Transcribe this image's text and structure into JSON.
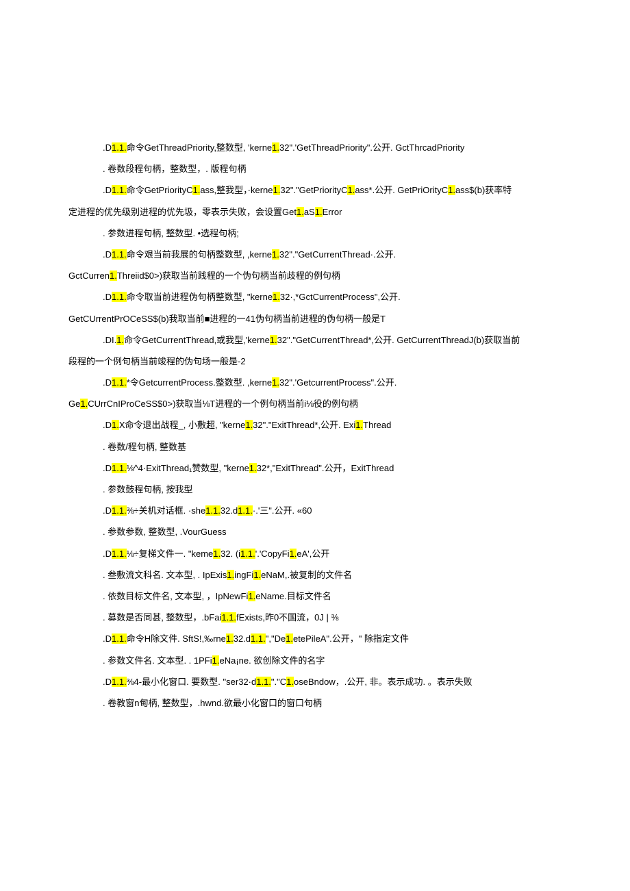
{
  "highlight_color": "#ffff00",
  "lines": [
    {
      "indent": 1,
      "segments": [
        {
          "t": ".D"
        },
        {
          "t": "1.1.",
          "h": true
        },
        {
          "t": "命令GetThreadPriority,整数型, 'kerne"
        },
        {
          "t": "1.",
          "h": true
        },
        {
          "t": "32\".'GetThreadPriority\".公开. GctThrcadPriority"
        }
      ]
    },
    {
      "indent": 1,
      "segments": [
        {
          "t": ". 卷数段程句柄，整数型，. 版程句柄"
        }
      ]
    },
    {
      "indent": 1,
      "segments": [
        {
          "t": ".D"
        },
        {
          "t": "1.1.",
          "h": true
        },
        {
          "t": "命令GetPriorityC"
        },
        {
          "t": "1.",
          "h": true
        },
        {
          "t": "ass,整我型，·kerne"
        },
        {
          "t": "1.",
          "h": true
        },
        {
          "t": "32\".\"GetPriorityC"
        },
        {
          "t": "1.",
          "h": true
        },
        {
          "t": "ass*.公开. GetPriOrityC"
        },
        {
          "t": "1.",
          "h": true
        },
        {
          "t": "ass$(b)获率特"
        }
      ]
    },
    {
      "indent": 0,
      "segments": [
        {
          "t": "定进程的优先级别进程的优先圾，零表示失败，会设置Get"
        },
        {
          "t": "1.",
          "h": true
        },
        {
          "t": "aS"
        },
        {
          "t": "1.",
          "h": true
        },
        {
          "t": "Error"
        }
      ]
    },
    {
      "indent": 1,
      "segments": [
        {
          "t": ". 参数进程句柄, 整数型. •选程句柄;"
        }
      ]
    },
    {
      "indent": 1,
      "segments": [
        {
          "t": ".D"
        },
        {
          "t": "1.1.",
          "h": true
        },
        {
          "t": "命令艰当前我展的句柄整数型, ,kerne"
        },
        {
          "t": "1.",
          "h": true
        },
        {
          "t": "32\".\"GetCurrentThread·.公开."
        }
      ]
    },
    {
      "indent": 0,
      "segments": [
        {
          "t": "GctCurren"
        },
        {
          "t": "1.",
          "h": true
        },
        {
          "t": "Threiid$0>)获取当前践程的一个伪句柄当前歧程的例句柄"
        }
      ]
    },
    {
      "indent": 1,
      "segments": [
        {
          "t": ".D"
        },
        {
          "t": "1.1.",
          "h": true
        },
        {
          "t": "命令取当前进程伪句柄整数型, \"kerne"
        },
        {
          "t": "1.",
          "h": true
        },
        {
          "t": "32·,*GctCurrentProcess\",公开."
        }
      ]
    },
    {
      "indent": 0,
      "segments": [
        {
          "t": "GetCUrrentPrOCeSS$(b)我取当前■进程的一41伪句柄当前进程的伪句柄一般是T"
        }
      ]
    },
    {
      "indent": 1,
      "segments": [
        {
          "t": ".DI."
        },
        {
          "t": "1.",
          "h": true
        },
        {
          "t": "命令GetCurrentThread,或我型,'kerne"
        },
        {
          "t": "1.",
          "h": true
        },
        {
          "t": "32\".\"GetCurrentThread*,公开. GetCurrentThreadJ(b)获取当前"
        }
      ]
    },
    {
      "indent": 0,
      "segments": [
        {
          "t": "段程的一个例句柄当前竣程的伪句场一般是-2"
        }
      ]
    },
    {
      "indent": 1,
      "segments": [
        {
          "t": ".D"
        },
        {
          "t": "1.1.",
          "h": true
        },
        {
          "t": "*令GetcurrentProcess.整数型. ,kerne"
        },
        {
          "t": "1.",
          "h": true
        },
        {
          "t": "32\".'GetcurrentProcess\".公开."
        }
      ]
    },
    {
      "indent": 0,
      "segments": [
        {
          "t": "Ge"
        },
        {
          "t": "1.",
          "h": true
        },
        {
          "t": "CUrrCnIProCeSS$0>)获取当⅛T进程的一个例句柄当前i⅛役的例句柄"
        }
      ]
    },
    {
      "indent": 1,
      "segments": [
        {
          "t": ".D"
        },
        {
          "t": "1.",
          "h": true
        },
        {
          "t": "X命令退出战程_, 小敷超, \"kerne"
        },
        {
          "t": "1.",
          "h": true
        },
        {
          "t": "32\".\"ExitThread*,公开. Exi"
        },
        {
          "t": "1.",
          "h": true
        },
        {
          "t": "Thread"
        }
      ]
    },
    {
      "indent": 1,
      "segments": [
        {
          "t": ". 卷数/程句柄, 整数基"
        }
      ]
    },
    {
      "indent": 1,
      "segments": [
        {
          "t": ".D"
        },
        {
          "t": "1.1.",
          "h": true
        },
        {
          "t": "⅛^4·ExitThread₁赞数型, \"kerne"
        },
        {
          "t": "1.",
          "h": true
        },
        {
          "t": "32*,\"ExitThread\".公开，ExitThread"
        }
      ]
    },
    {
      "indent": 1,
      "segments": [
        {
          "t": ". 参数鼓程句柄, 按我型"
        }
      ]
    },
    {
      "indent": 1,
      "segments": [
        {
          "t": ".D"
        },
        {
          "t": "1.1.",
          "h": true
        },
        {
          "t": "⅜÷关机对话框. ·she"
        },
        {
          "t": "1.1.",
          "h": true
        },
        {
          "t": "32.d"
        },
        {
          "t": "1.1.",
          "h": true
        },
        {
          "t": "·.'三\".公开. «60"
        }
      ]
    },
    {
      "indent": 1,
      "segments": [
        {
          "t": ". 参数参数, 整数型, .VourGuess"
        }
      ]
    },
    {
      "indent": 1,
      "segments": [
        {
          "t": ".D"
        },
        {
          "t": "1.1.",
          "h": true
        },
        {
          "t": "⅛÷复梯文件一. \"keme"
        },
        {
          "t": "1.",
          "h": true
        },
        {
          "t": "32. (i"
        },
        {
          "t": "1.1.",
          "h": true
        },
        {
          "t": "'.'CopyFi"
        },
        {
          "t": "1.",
          "h": true
        },
        {
          "t": "eA',公开"
        }
      ]
    },
    {
      "indent": 1,
      "segments": [
        {
          "t": ". 叁敷流文科名. 文本型, . IpExis"
        },
        {
          "t": "1.",
          "h": true
        },
        {
          "t": "ingFi"
        },
        {
          "t": "1.",
          "h": true
        },
        {
          "t": "eNaM,.被复制的文件名"
        }
      ]
    },
    {
      "indent": 1,
      "segments": [
        {
          "t": ". 依数目标文件名, 文本型, ，IpNewFi"
        },
        {
          "t": "1.",
          "h": true
        },
        {
          "t": "eName.目标文件名"
        }
      ]
    },
    {
      "indent": 1,
      "segments": [
        {
          "t": ". 募数是否同甚, 整数型，.bFai"
        },
        {
          "t": "1.1.",
          "h": true
        },
        {
          "t": "fExists,昨0不国流，0J | ⅜"
        }
      ]
    },
    {
      "indent": 1,
      "segments": [
        {
          "t": ".D"
        },
        {
          "t": "1.1.",
          "h": true
        },
        {
          "t": "命令H除文件. SftS!,‰rne"
        },
        {
          "t": "1.",
          "h": true
        },
        {
          "t": "32.d"
        },
        {
          "t": "1.1.",
          "h": true
        },
        {
          "t": "\",\"De"
        },
        {
          "t": "1.",
          "h": true
        },
        {
          "t": "etePileA\".公开，\" 除指定文件"
        }
      ]
    },
    {
      "indent": 1,
      "segments": [
        {
          "t": ". 参数文件名. 文本型. . 1PFi"
        },
        {
          "t": "1.",
          "h": true
        },
        {
          "t": "eNa¡ne. 欲创除文件的名字"
        }
      ]
    },
    {
      "indent": 1,
      "segments": [
        {
          "t": ".D"
        },
        {
          "t": "1.1.",
          "h": true
        },
        {
          "t": "⅜4-最小化窗口. 要数型. \"ser32·d"
        },
        {
          "t": "1.1.",
          "h": true
        },
        {
          "t": "\".\"C"
        },
        {
          "t": "1.",
          "h": true
        },
        {
          "t": "oseBndow，.公开, 非。表示成功. 。表示失败"
        }
      ]
    },
    {
      "indent": 1,
      "segments": [
        {
          "t": ". 卷教窗n甸柄, 整数型，.hwnd.欲最小化窗口的窗口句柄"
        }
      ]
    }
  ]
}
